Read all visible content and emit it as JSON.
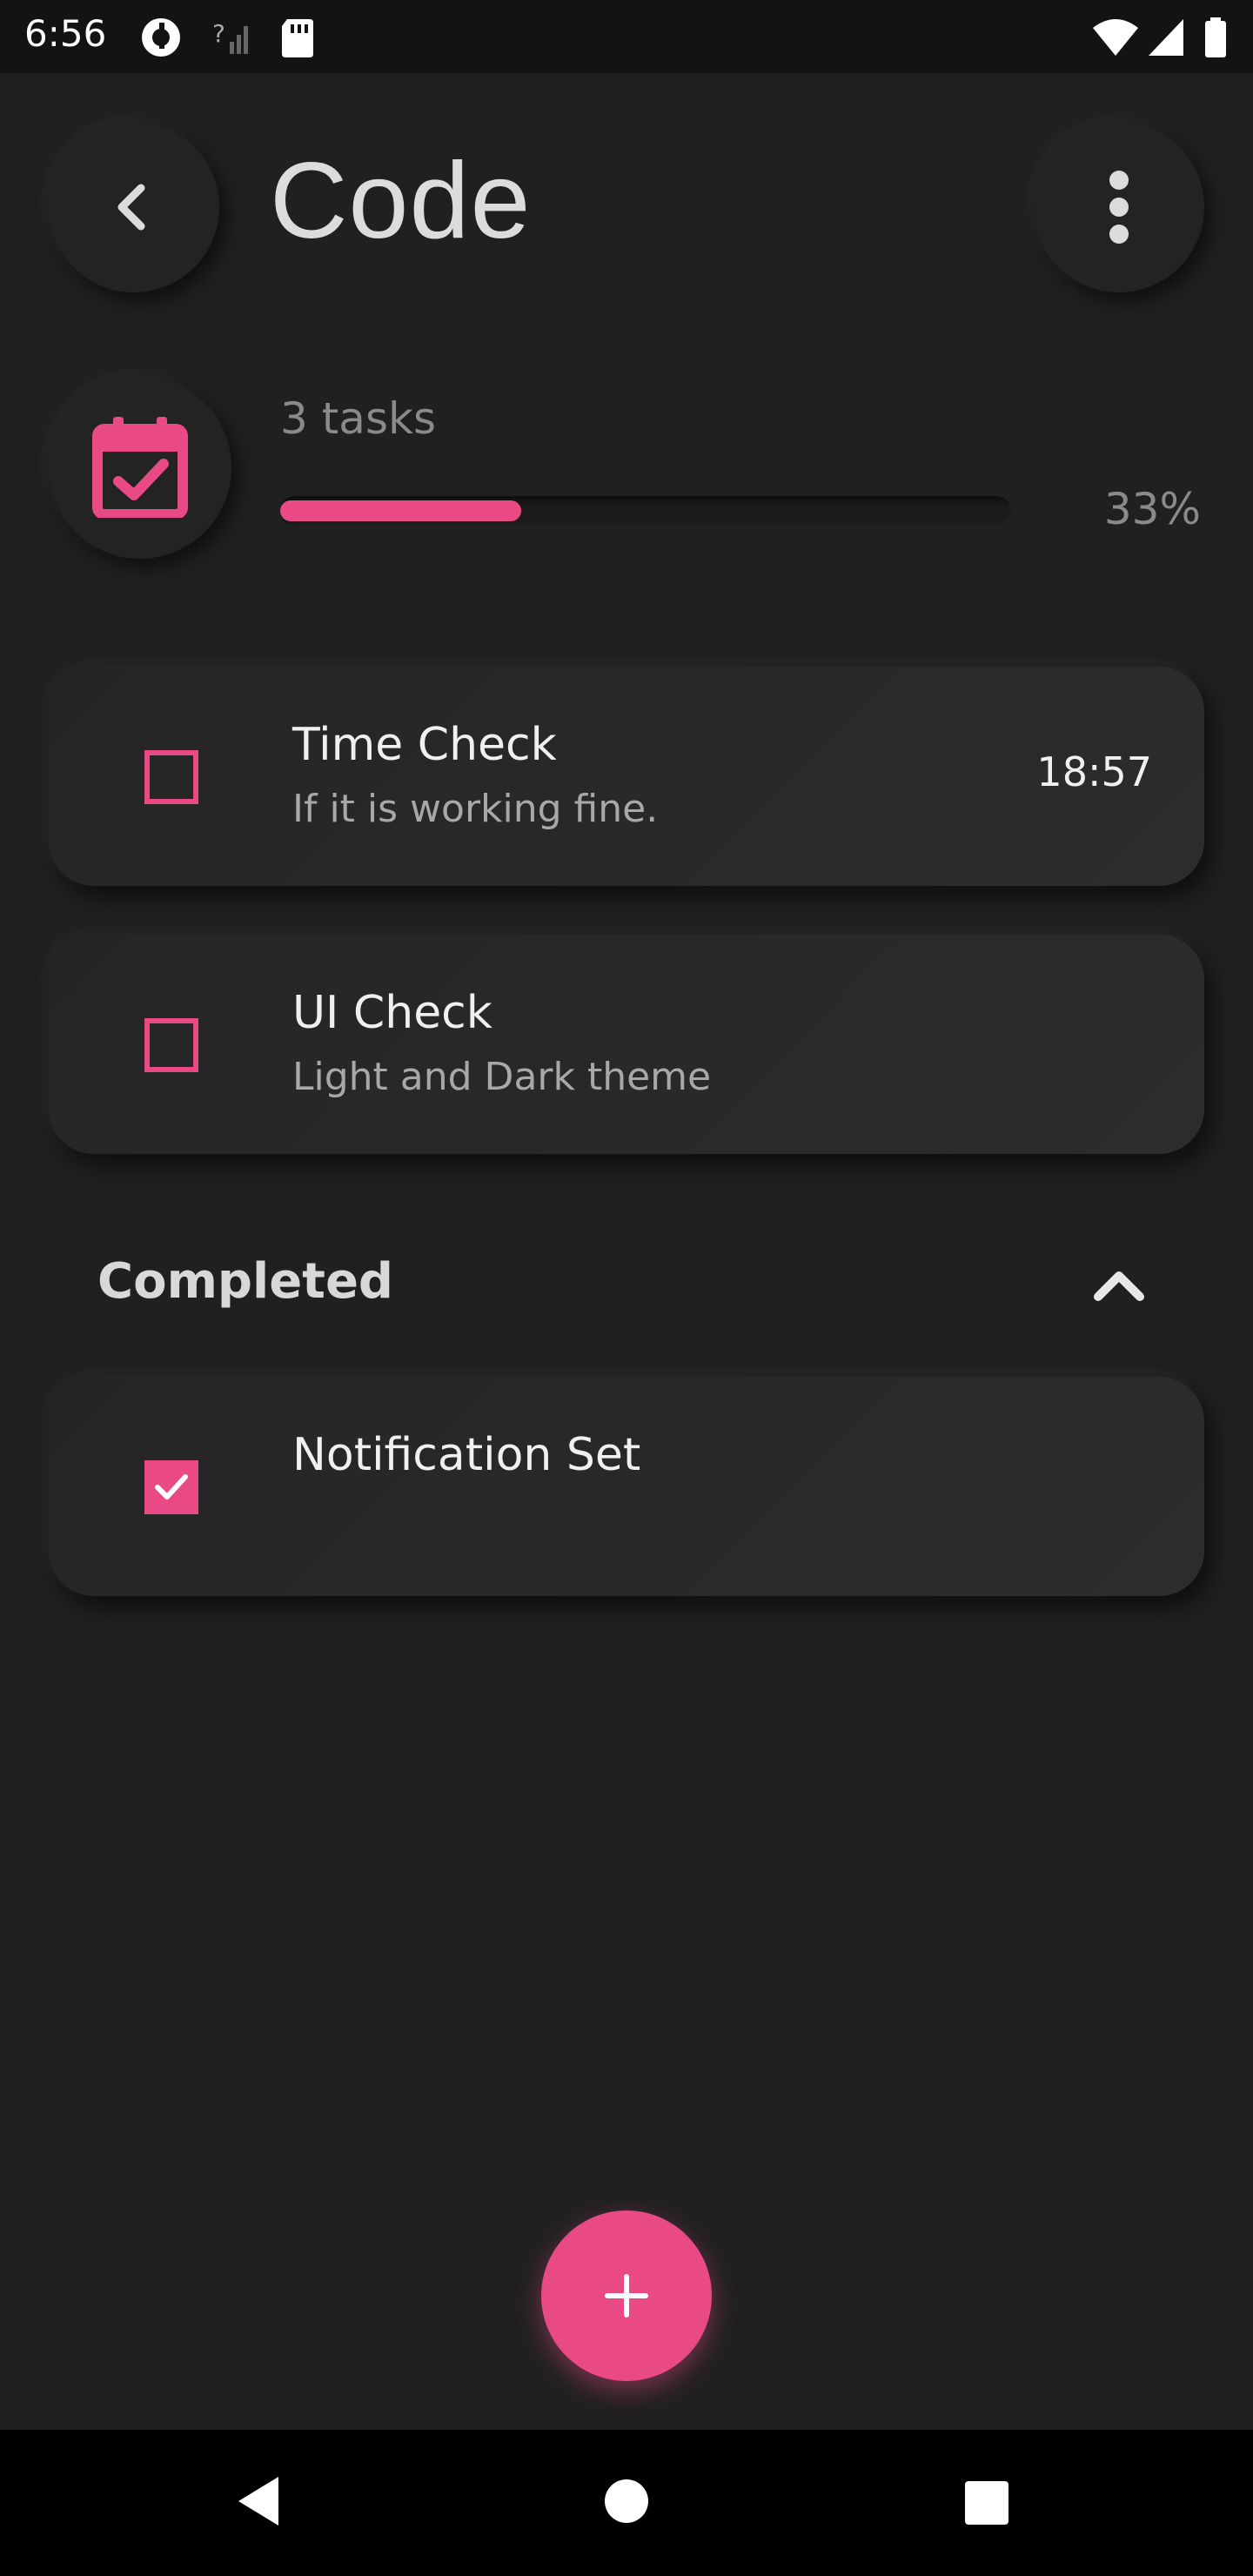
{
  "status_bar": {
    "time": "6:56"
  },
  "header": {
    "title": "Code"
  },
  "progress": {
    "count_label": "3 tasks",
    "percent_label": "33%",
    "fraction": 0.33
  },
  "tasks": [
    {
      "title": "Time Check",
      "subtitle": "If it is working fine.",
      "time": "18:57",
      "checked": false
    },
    {
      "title": "UI Check",
      "subtitle": "Light and Dark theme",
      "checked": false
    }
  ],
  "completed": {
    "label": "Completed",
    "items": [
      {
        "title": "Notification Set",
        "checked": true
      }
    ]
  },
  "colors": {
    "accent": "#e94a85",
    "background": "#202020",
    "card": "#2a2a2a"
  },
  "icons": {
    "back": "chevron-left-icon",
    "more": "more-vertical-icon",
    "calendar": "calendar-check-icon",
    "collapse": "chevron-up-icon",
    "add": "plus-icon"
  }
}
